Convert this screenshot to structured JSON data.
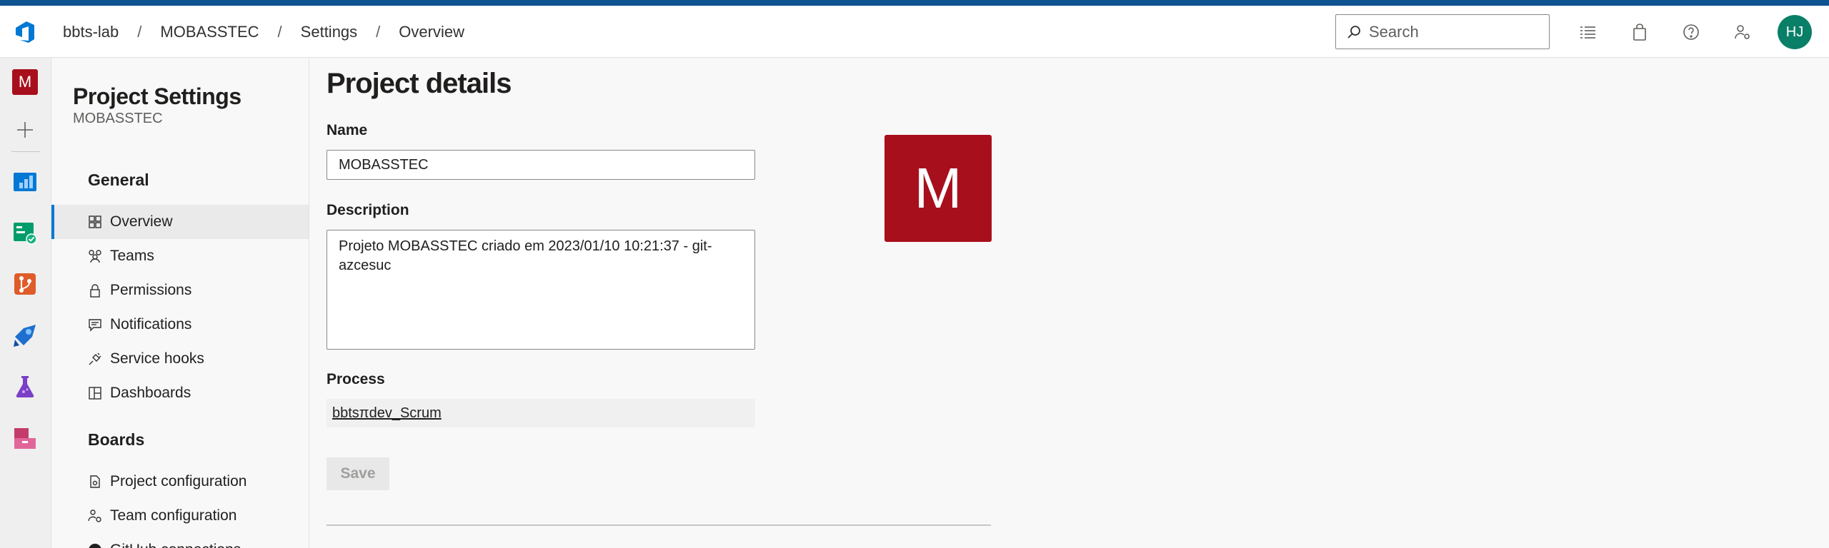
{
  "header": {
    "breadcrumb": [
      "bbts-lab",
      "MOBASSTEC",
      "Settings",
      "Overview"
    ],
    "breadcrumb_separator": "/",
    "search_placeholder": "Search",
    "user_initials": "HJ",
    "accent_color": "#0f5391"
  },
  "rail": {
    "project_initial": "M",
    "items": [
      "add-icon",
      "overview-icon",
      "boards-icon",
      "repos-icon",
      "pipelines-icon",
      "test-plans-icon",
      "artifacts-icon"
    ]
  },
  "settings_nav": {
    "title": "Project Settings",
    "subtitle": "MOBASSTEC",
    "sections": [
      {
        "label": "General",
        "items": [
          "Overview",
          "Teams",
          "Permissions",
          "Notifications",
          "Service hooks",
          "Dashboards"
        ]
      },
      {
        "label": "Boards",
        "items": [
          "Project configuration",
          "Team configuration",
          "GitHub connections"
        ]
      }
    ],
    "selected": "Overview"
  },
  "main": {
    "title": "Project details",
    "name_label": "Name",
    "name_value": "MOBASSTEC",
    "description_label": "Description",
    "description_value": "Projeto MOBASSTEC criado em 2023/01/10 10:21:37 - git-azcesuc",
    "process_label": "Process",
    "process_value": "bbtsπdev_Scrum",
    "save_label": "Save",
    "avatar_initial": "M",
    "avatar_color": "#a80f1c"
  }
}
